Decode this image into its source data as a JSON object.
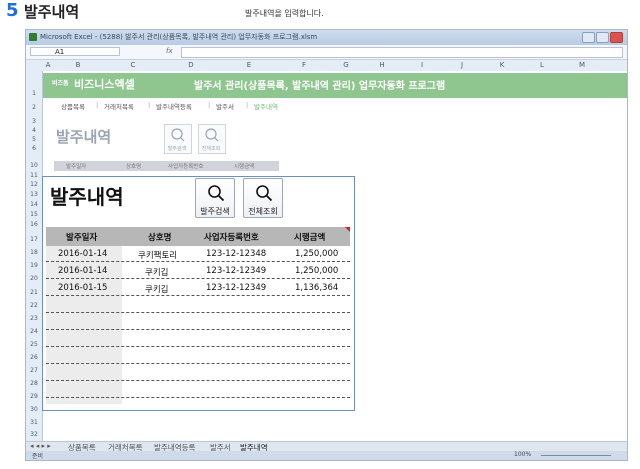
{
  "page": {
    "step_number": "5",
    "step_title": "발주내역",
    "description": "발주내역을 입력합니다."
  },
  "window": {
    "title": "Microsoft Excel - (5288) 발주서 관리(상품목록, 발주내역 관리) 업무자동화 프로그램.xlsm",
    "name_box": "A1",
    "fx": "fx"
  },
  "columns": [
    "A",
    "B",
    "C",
    "D",
    "E",
    "F",
    "G",
    "H",
    "I",
    "J",
    "K",
    "L",
    "M"
  ],
  "rows": [
    "1",
    "2",
    "3",
    "4",
    "5",
    "6",
    "10",
    "11",
    "12",
    "13",
    "14",
    "15",
    "16",
    "17",
    "18",
    "19",
    "20",
    "21",
    "22",
    "23",
    "24",
    "25",
    "26",
    "27",
    "28",
    "29",
    "30",
    "31",
    "32"
  ],
  "banner": {
    "brand_small": "비즈폼",
    "brand": "비즈니스엑셀",
    "title": "발주서 관리(상품목록, 발주내역 관리) 업무자동화 프로그램"
  },
  "nav": [
    "상품목록",
    "거래처목록",
    "발주내역등록",
    "발주서",
    "발주내역"
  ],
  "nav_separator": "|",
  "popup": {
    "title": "발주내역",
    "buttons": [
      {
        "label": "발주검색",
        "icon": "search-icon"
      },
      {
        "label": "전체조회",
        "icon": "search-icon"
      }
    ],
    "columns": [
      "발주일자",
      "상호명",
      "사업자등록번호",
      "시행금액"
    ],
    "rows": [
      {
        "date": "2016-01-14",
        "company": "쿠키팩토리",
        "biz_no": "123-12-12348",
        "amount": "1,250,000"
      },
      {
        "date": "2016-01-14",
        "company": "쿠키깁",
        "biz_no": "123-12-12349",
        "amount": "1,250,000"
      },
      {
        "date": "2016-01-15",
        "company": "쿠키깁",
        "biz_no": "123-12-12349",
        "amount": "1,136,364"
      }
    ]
  },
  "sheet_tabs": [
    "상품목록",
    "거래처목록",
    "발주내역등록",
    "발주서",
    "발주내역"
  ],
  "status": {
    "ready": "준비",
    "zoom": "100%"
  },
  "colors": {
    "banner": "#8fc68f",
    "accent": "#1e6fd9",
    "popup_border": "#6d8fc5"
  }
}
